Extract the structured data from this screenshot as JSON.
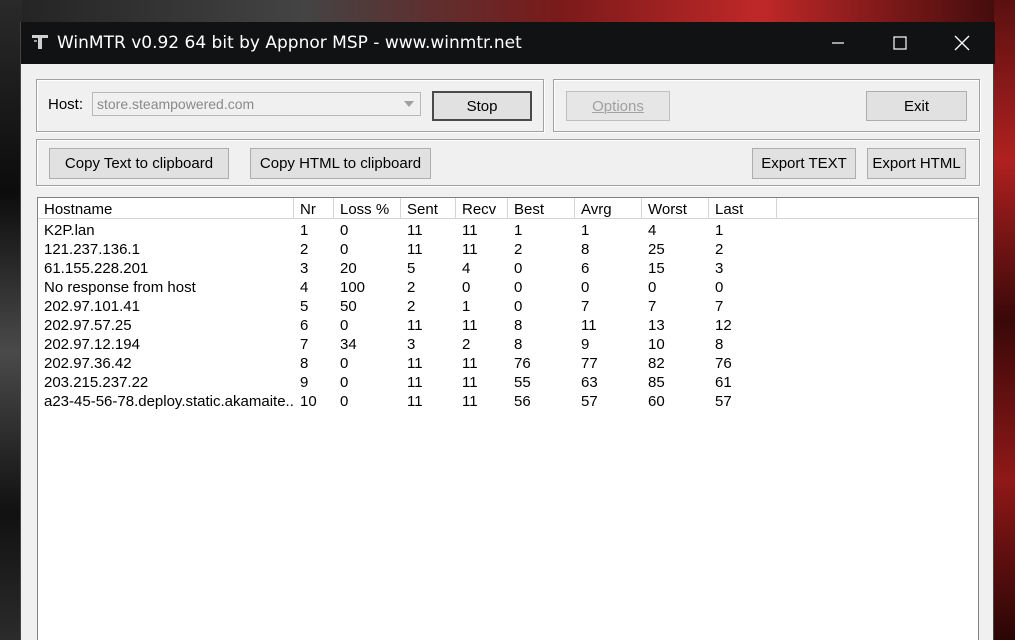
{
  "window": {
    "title": "WinMTR v0.92 64 bit by Appnor MSP - www.winmtr.net"
  },
  "host": {
    "label": "Host:",
    "value": "store.steampowered.com"
  },
  "buttons": {
    "stop": "Stop",
    "options": "Options",
    "exit": "Exit",
    "copy_text": "Copy Text to clipboard",
    "copy_html": "Copy HTML to clipboard",
    "export_text": "Export TEXT",
    "export_html": "Export HTML"
  },
  "table": {
    "columns": [
      "Hostname",
      "Nr",
      "Loss %",
      "Sent",
      "Recv",
      "Best",
      "Avrg",
      "Worst",
      "Last"
    ],
    "rows": [
      [
        "K2P.lan",
        "1",
        "0",
        "11",
        "11",
        "1",
        "1",
        "4",
        "1"
      ],
      [
        "121.237.136.1",
        "2",
        "0",
        "11",
        "11",
        "2",
        "8",
        "25",
        "2"
      ],
      [
        "61.155.228.201",
        "3",
        "20",
        "5",
        "4",
        "0",
        "6",
        "15",
        "3"
      ],
      [
        "No response from host",
        "4",
        "100",
        "2",
        "0",
        "0",
        "0",
        "0",
        "0"
      ],
      [
        "202.97.101.41",
        "5",
        "50",
        "2",
        "1",
        "0",
        "7",
        "7",
        "7"
      ],
      [
        "202.97.57.25",
        "6",
        "0",
        "11",
        "11",
        "8",
        "11",
        "13",
        "12"
      ],
      [
        "202.97.12.194",
        "7",
        "34",
        "3",
        "2",
        "8",
        "9",
        "10",
        "8"
      ],
      [
        "202.97.36.42",
        "8",
        "0",
        "11",
        "11",
        "76",
        "77",
        "82",
        "76"
      ],
      [
        "203.215.237.22",
        "9",
        "0",
        "11",
        "11",
        "55",
        "63",
        "85",
        "61"
      ],
      [
        "a23-45-56-78.deploy.static.akamaite...",
        "10",
        "0",
        "11",
        "11",
        "56",
        "57",
        "60",
        "57"
      ]
    ]
  }
}
